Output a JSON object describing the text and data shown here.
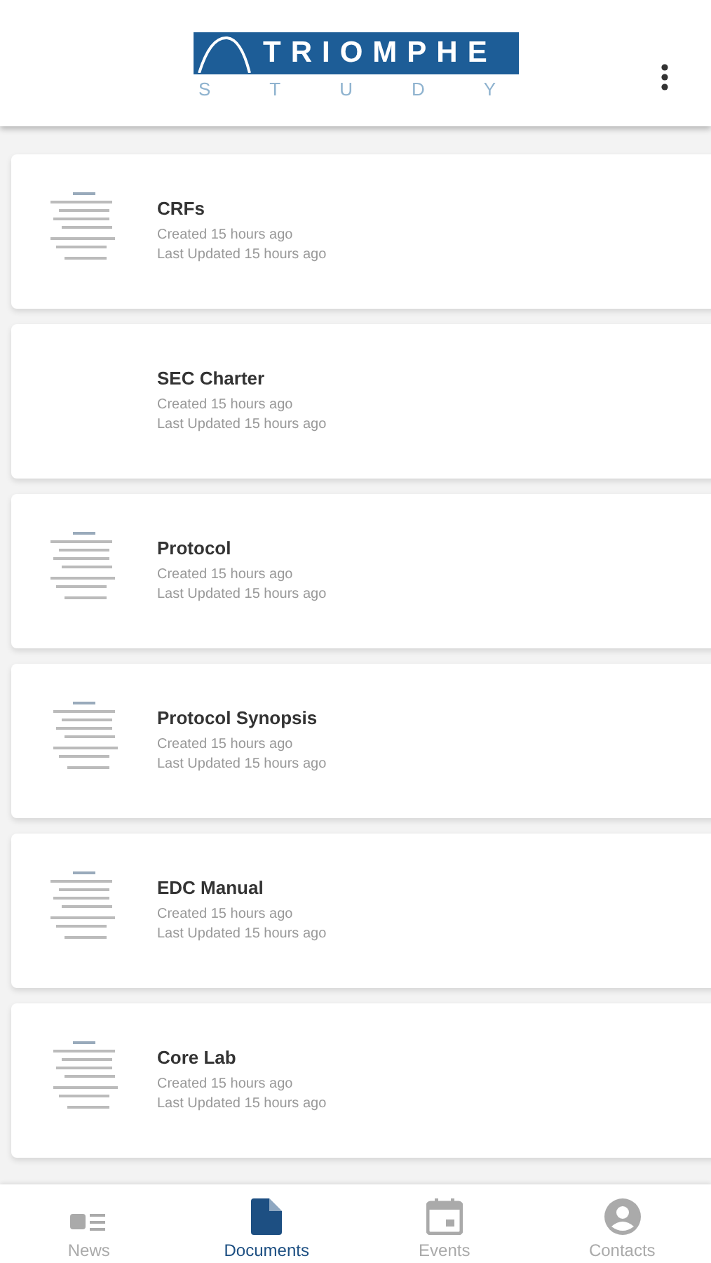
{
  "header": {
    "logo_word": "TRIOMPHE",
    "logo_sub": "STUDY"
  },
  "documents": [
    {
      "title": "CRFs",
      "created": "Created 15 hours ago",
      "updated": "Last Updated 15 hours ago"
    },
    {
      "title": "SEC Charter",
      "created": "Created 15 hours ago",
      "updated": "Last Updated 15 hours ago"
    },
    {
      "title": "Protocol",
      "created": "Created 15 hours ago",
      "updated": "Last Updated 15 hours ago"
    },
    {
      "title": "Protocol Synopsis",
      "created": "Created 15 hours ago",
      "updated": "Last Updated 15 hours ago"
    },
    {
      "title": "EDC Manual",
      "created": "Created 15 hours ago",
      "updated": "Last Updated 15 hours ago"
    },
    {
      "title": "Core Lab",
      "created": "Created 15 hours ago",
      "updated": "Last Updated 15 hours ago"
    }
  ],
  "nav": [
    {
      "label": "News",
      "kind": "news",
      "selected": false
    },
    {
      "label": "Documents",
      "kind": "documents",
      "selected": true
    },
    {
      "label": "Events",
      "kind": "events",
      "selected": false
    },
    {
      "label": "Contacts",
      "kind": "contacts",
      "selected": false
    }
  ]
}
